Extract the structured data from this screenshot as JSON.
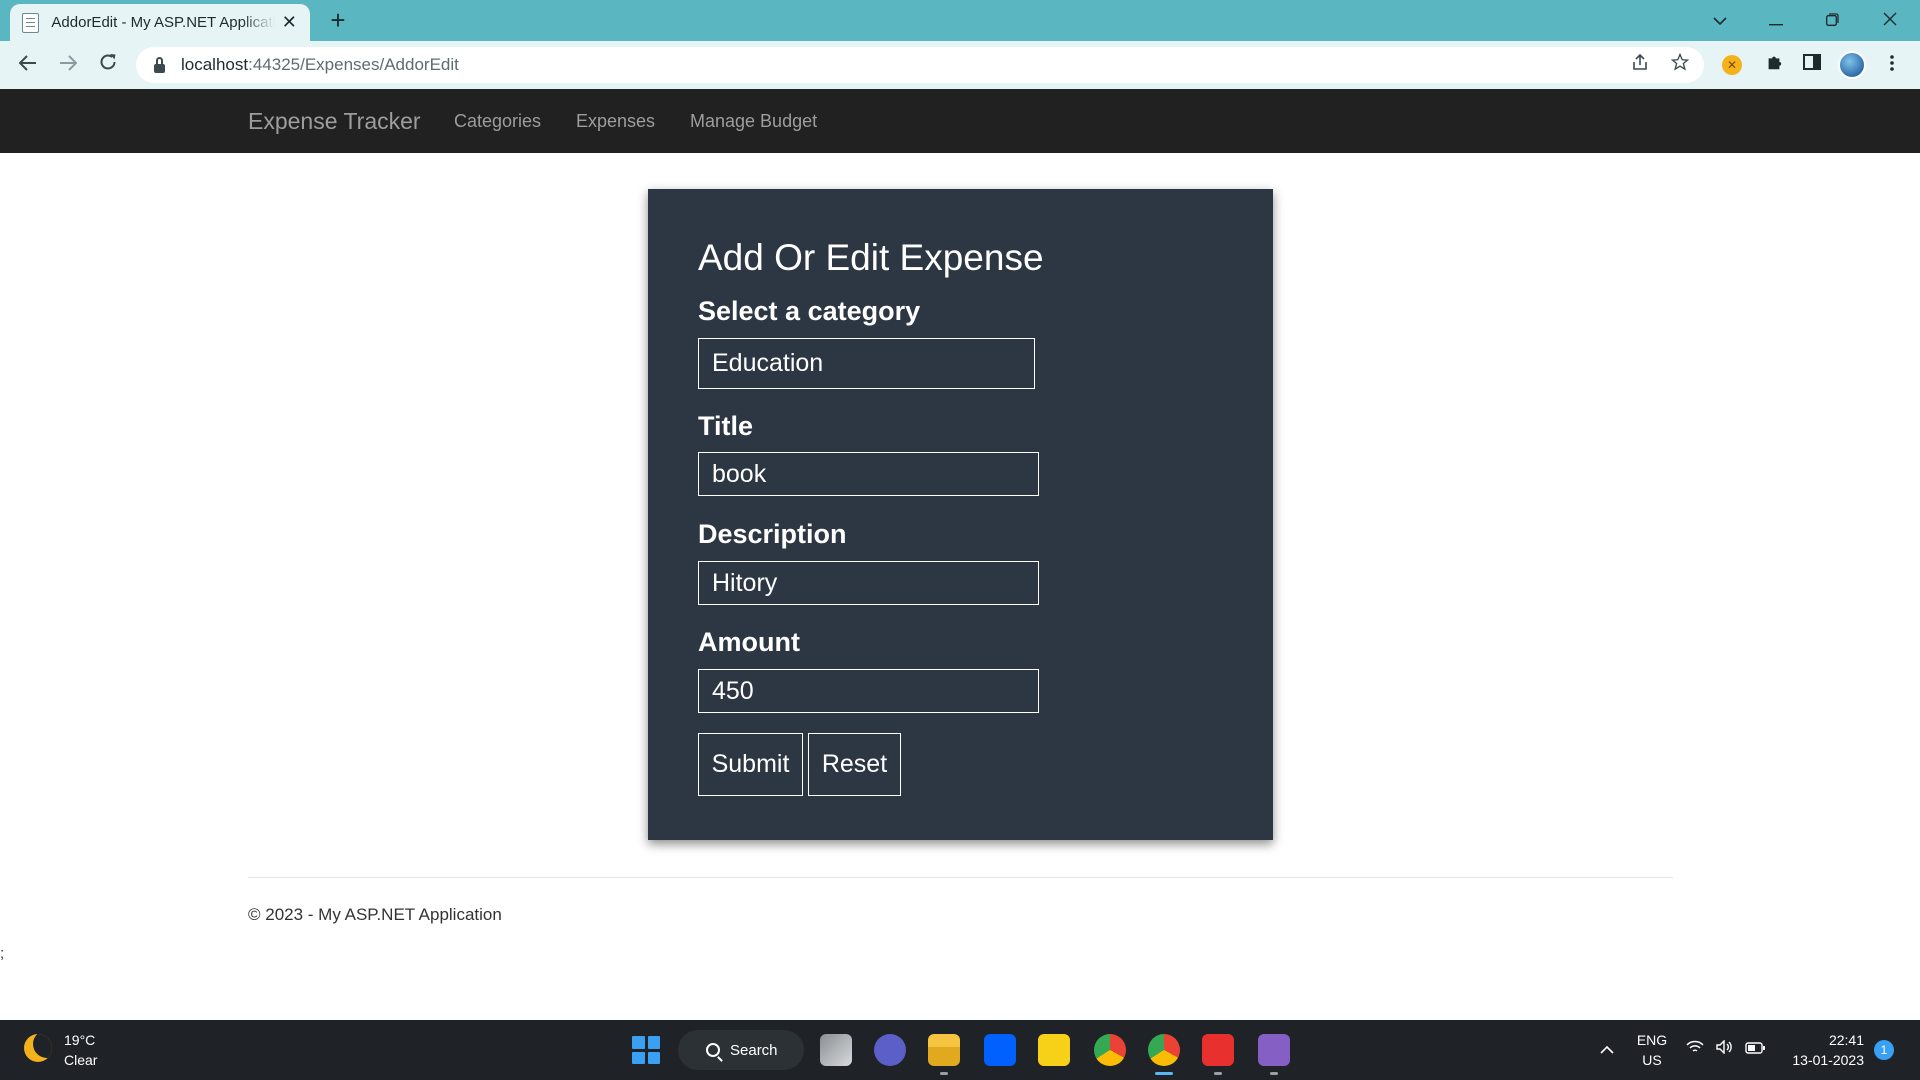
{
  "browser": {
    "tab_title": "AddorEdit - My ASP.NET Application",
    "tab_close": "✕",
    "new_tab": "+",
    "url_host": "localhost",
    "url_path": ":44325/Expenses/AddorEdit",
    "icons": {
      "back": "arrow-left-icon",
      "forward": "arrow-right-icon",
      "reload": "reload-icon",
      "lock": "lock-icon",
      "share": "share-icon",
      "bookmark": "star-icon",
      "extension": "extension-icon",
      "puzzle": "puzzle-icon",
      "sidepanel": "side-panel-icon",
      "menu": "kebab-menu-icon"
    }
  },
  "navbar": {
    "brand": "Expense Tracker",
    "links": [
      "Categories",
      "Expenses",
      "Manage Budget"
    ]
  },
  "form": {
    "title": "Add Or Edit Expense",
    "category": {
      "label": "Select a category",
      "value": "Education"
    },
    "title_field": {
      "label": "Title",
      "value": "book"
    },
    "description": {
      "label": "Description",
      "value": "Hitory"
    },
    "amount": {
      "label": "Amount",
      "value": "450"
    },
    "submit_label": "Submit",
    "reset_label": "Reset"
  },
  "footer": {
    "text": "© 2023 - My ASP.NET Application",
    "stray": ";"
  },
  "taskbar": {
    "weather_temp": "19°C",
    "weather_cond": "Clear",
    "search_label": "Search",
    "language_top": "ENG",
    "language_bottom": "US",
    "time": "22:41",
    "date": "13-01-2023",
    "notification_count": "1"
  },
  "colors": {
    "tabstrip": "#5ab7c2",
    "navbar": "#212121",
    "card": "#2c3743",
    "accent_blue": "#3aa0f3"
  }
}
